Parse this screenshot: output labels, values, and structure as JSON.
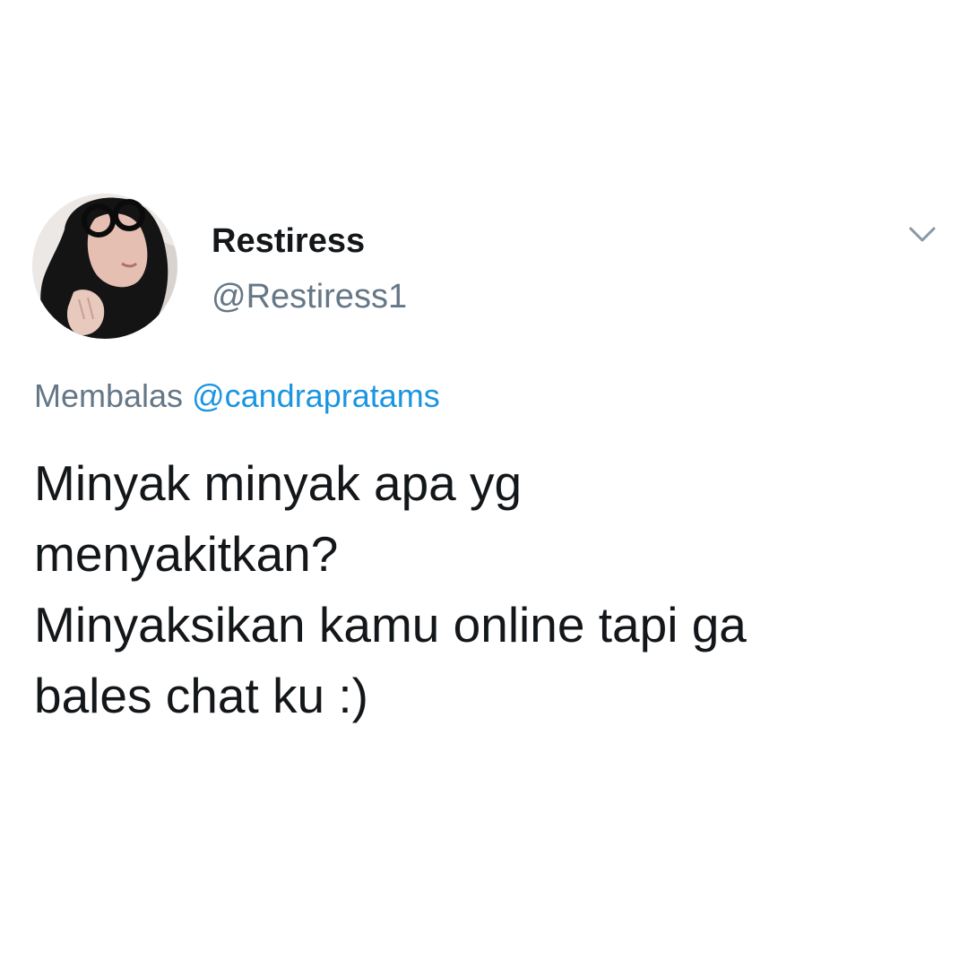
{
  "tweet": {
    "display_name": "Restiress",
    "handle": "@Restiress1",
    "reply_prefix": "Membalas",
    "reply_to": "@candrapratams",
    "text_lines": [
      "Minyak minyak apa yg",
      "menyakitkan?",
      "Minyaksikan kamu online tapi ga",
      "bales chat ku :)"
    ],
    "menu_icon": "chevron-down-icon",
    "avatar_icon": "profile-photo"
  },
  "colors": {
    "text": "#14171a",
    "secondary": "#657786",
    "link": "#1b95e0",
    "background": "#ffffff"
  }
}
